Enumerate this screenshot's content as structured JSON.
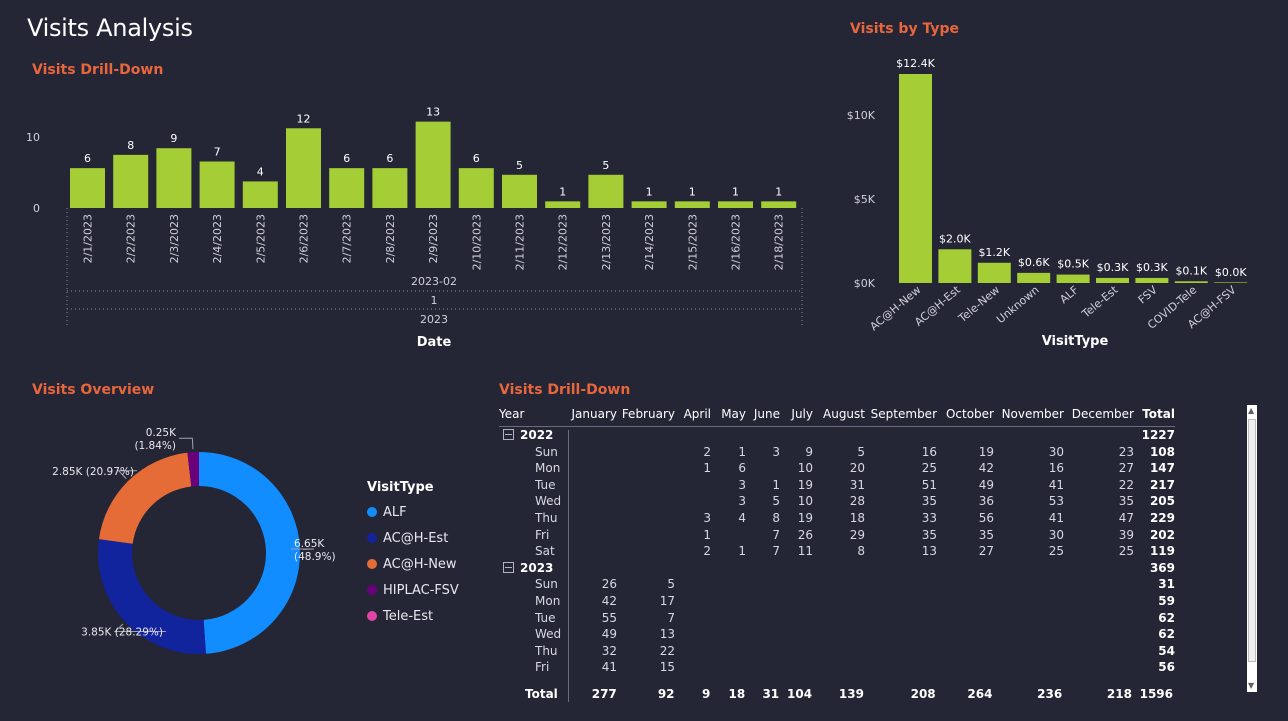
{
  "page_title": "Visits Analysis",
  "drilldown_chart": {
    "title": "Visits Drill-Down",
    "xlabel": "Date",
    "month_label": "2023-02",
    "quarter_label": "1",
    "year_label": "2023",
    "ytick_labels": [
      "0",
      "10"
    ]
  },
  "type_chart": {
    "title": "Visits by Type",
    "xlabel": "VisitType",
    "ytick_labels": [
      "$0K",
      "$5K",
      "$10K"
    ]
  },
  "overview_chart": {
    "title": "Visits Overview",
    "legend_title": "VisitType"
  },
  "chart_data": [
    {
      "type": "bar",
      "title": "Visits Drill-Down",
      "xlabel": "Date",
      "ylabel": "",
      "categories": [
        "2/1/2023",
        "2/2/2023",
        "2/3/2023",
        "2/4/2023",
        "2/5/2023",
        "2/6/2023",
        "2/7/2023",
        "2/8/2023",
        "2/9/2023",
        "2/10/2023",
        "2/11/2023",
        "2/12/2023",
        "2/13/2023",
        "2/14/2023",
        "2/15/2023",
        "2/16/2023",
        "2/18/2023"
      ],
      "values": [
        6,
        8,
        9,
        7,
        4,
        12,
        6,
        6,
        13,
        6,
        5,
        1,
        5,
        1,
        1,
        1,
        1
      ],
      "data_labels": [
        "6",
        "8",
        "9",
        "7",
        "4",
        "12",
        "6",
        "6",
        "13",
        "6",
        "5",
        "1",
        "5",
        "1",
        "1",
        "1",
        "1"
      ],
      "ylim": [
        0,
        14
      ],
      "yticks": [
        0,
        10
      ],
      "grid": false,
      "color": "#a4cd36"
    },
    {
      "type": "bar",
      "title": "Visits by Type",
      "xlabel": "VisitType",
      "ylabel": "",
      "categories": [
        "AC@H-New",
        "AC@H-Est",
        "Tele-New",
        "Unknown",
        "ALF",
        "Tele-Est",
        "FSV",
        "COVID-Tele",
        "AC@H-FSV"
      ],
      "values": [
        12.4,
        2.0,
        1.2,
        0.6,
        0.5,
        0.3,
        0.3,
        0.1,
        0.0
      ],
      "data_labels": [
        "$12.4K",
        "$2.0K",
        "$1.2K",
        "$0.6K",
        "$0.5K",
        "$0.3K",
        "$0.3K",
        "$0.1K",
        "$0.0K"
      ],
      "ylim": [
        0,
        13
      ],
      "yticks": [
        0,
        5,
        10
      ],
      "grid": false,
      "color": "#a4cd36"
    },
    {
      "type": "pie",
      "title": "Visits Overview",
      "legend_title": "VisitType",
      "legend_placement": "right",
      "categories": [
        "ALF",
        "AC@H-Est",
        "AC@H-New",
        "HIPLAC-FSV",
        "Tele-Est"
      ],
      "values": [
        48.9,
        28.29,
        20.97,
        1.84,
        0.0
      ],
      "data_labels": [
        "6.65K (48.9%)",
        "3.85K (28.29%)",
        "2.85K (20.97%)",
        "0.25K (1.84%)",
        ""
      ],
      "colors": [
        "#118dff",
        "#12239e",
        "#e66c37",
        "#6b007b",
        "#e044a7"
      ]
    }
  ],
  "matrix": {
    "title": "Visits Drill-Down",
    "headers": [
      "Year",
      "January",
      "February",
      "April",
      "May",
      "June",
      "July",
      "August",
      "September",
      "October",
      "November",
      "December",
      "Total"
    ],
    "rows": [
      {
        "kind": "year",
        "cells": [
          "2022",
          "",
          "",
          "",
          "",
          "",
          "",
          "",
          "",
          "",
          "",
          "",
          "1227"
        ]
      },
      {
        "kind": "day",
        "cells": [
          "Sun",
          "",
          "",
          "2",
          "1",
          "3",
          "9",
          "5",
          "16",
          "19",
          "30",
          "23",
          "108"
        ]
      },
      {
        "kind": "day",
        "cells": [
          "Mon",
          "",
          "",
          "1",
          "6",
          "",
          "10",
          "20",
          "25",
          "42",
          "16",
          "27",
          "147"
        ]
      },
      {
        "kind": "day",
        "cells": [
          "Tue",
          "",
          "",
          "",
          "3",
          "1",
          "19",
          "31",
          "51",
          "49",
          "41",
          "22",
          "217"
        ]
      },
      {
        "kind": "day",
        "cells": [
          "Wed",
          "",
          "",
          "",
          "3",
          "5",
          "10",
          "28",
          "35",
          "36",
          "53",
          "35",
          "205"
        ]
      },
      {
        "kind": "day",
        "cells": [
          "Thu",
          "",
          "",
          "3",
          "4",
          "8",
          "19",
          "18",
          "33",
          "56",
          "41",
          "47",
          "229"
        ]
      },
      {
        "kind": "day",
        "cells": [
          "Fri",
          "",
          "",
          "1",
          "",
          "7",
          "26",
          "29",
          "35",
          "35",
          "30",
          "39",
          "202"
        ]
      },
      {
        "kind": "day",
        "cells": [
          "Sat",
          "",
          "",
          "2",
          "1",
          "7",
          "11",
          "8",
          "13",
          "27",
          "25",
          "25",
          "119"
        ]
      },
      {
        "kind": "year",
        "cells": [
          "2023",
          "",
          "",
          "",
          "",
          "",
          "",
          "",
          "",
          "",
          "",
          "",
          "369"
        ]
      },
      {
        "kind": "day",
        "cells": [
          "Sun",
          "26",
          "5",
          "",
          "",
          "",
          "",
          "",
          "",
          "",
          "",
          "",
          "31"
        ]
      },
      {
        "kind": "day",
        "cells": [
          "Mon",
          "42",
          "17",
          "",
          "",
          "",
          "",
          "",
          "",
          "",
          "",
          "",
          "59"
        ]
      },
      {
        "kind": "day",
        "cells": [
          "Tue",
          "55",
          "7",
          "",
          "",
          "",
          "",
          "",
          "",
          "",
          "",
          "",
          "62"
        ]
      },
      {
        "kind": "day",
        "cells": [
          "Wed",
          "49",
          "13",
          "",
          "",
          "",
          "",
          "",
          "",
          "",
          "",
          "",
          "62"
        ]
      },
      {
        "kind": "day",
        "cells": [
          "Thu",
          "32",
          "22",
          "",
          "",
          "",
          "",
          "",
          "",
          "",
          "",
          "",
          "54"
        ]
      },
      {
        "kind": "day",
        "cells": [
          "Fri",
          "41",
          "15",
          "",
          "",
          "",
          "",
          "",
          "",
          "",
          "",
          "",
          "56"
        ]
      }
    ],
    "totals": [
      "Total",
      "277",
      "92",
      "9",
      "18",
      "31",
      "104",
      "139",
      "208",
      "264",
      "236",
      "218",
      "1596"
    ]
  }
}
